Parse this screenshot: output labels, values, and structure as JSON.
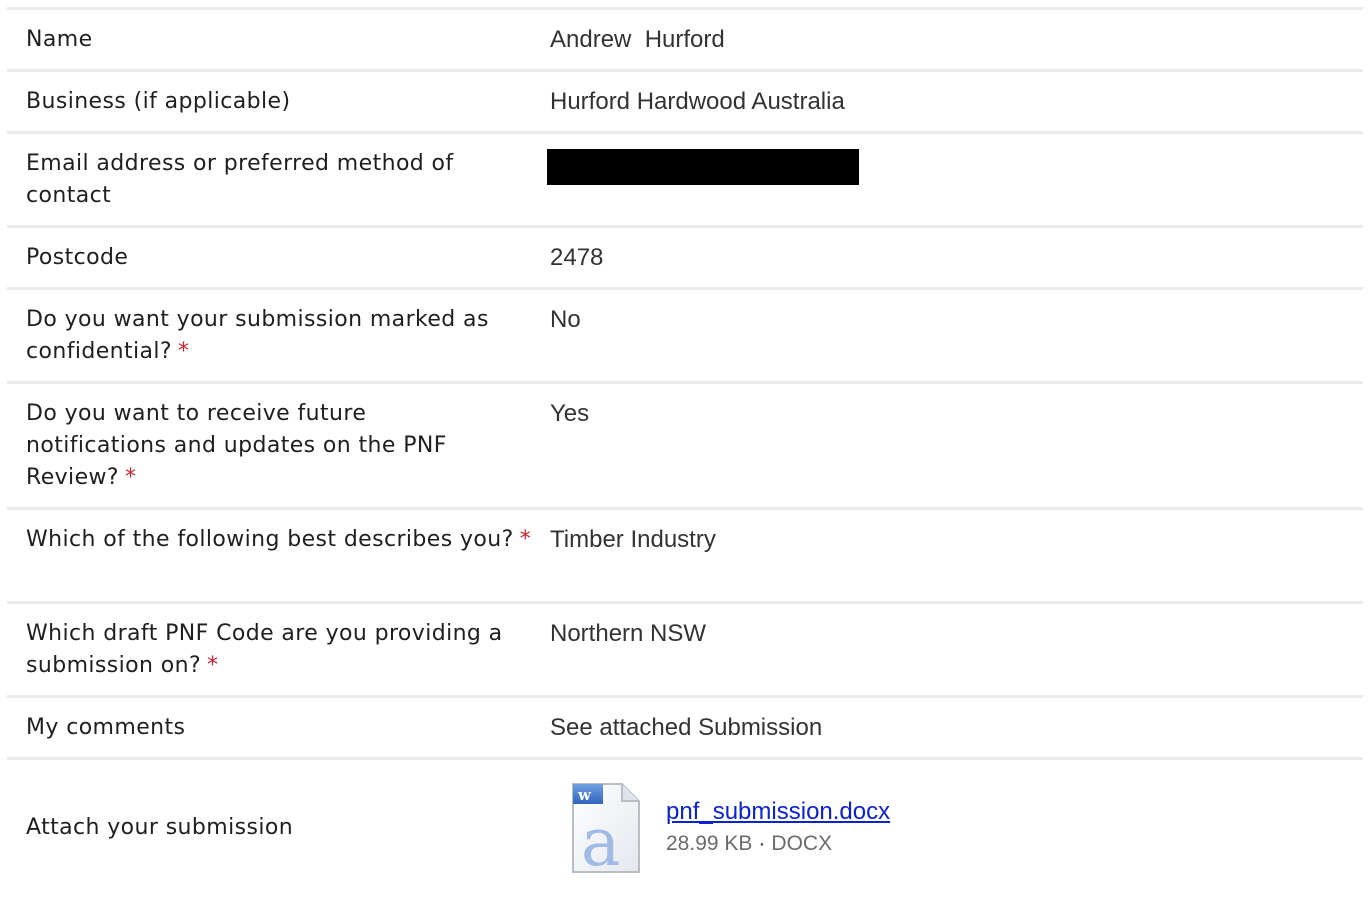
{
  "rows": [
    {
      "label": "Name",
      "required": false,
      "value": "Andrew  Hurford"
    },
    {
      "label": "Business (if applicable)",
      "required": false,
      "value": "Hurford Hardwood Australia"
    },
    {
      "label": "Email address or preferred method of contact",
      "required": false,
      "value": ""
    },
    {
      "label": "Postcode",
      "required": false,
      "value": "2478"
    },
    {
      "label": "Do you want your submission marked as confidential?",
      "required": true,
      "value": "No"
    },
    {
      "label": "Do you want to receive future notifications and updates on the PNF Review?",
      "required": true,
      "value": "Yes"
    },
    {
      "label": "Which of the following best describes you?",
      "required": true,
      "value": "Timber Industry"
    },
    {
      "label": "Which draft PNF Code are you providing a submission on?",
      "required": true,
      "value": "Northern NSW"
    },
    {
      "label": "My comments",
      "required": false,
      "value": "See attached Submission"
    }
  ],
  "attachment": {
    "label": "Attach your submission",
    "file_name": "pnf_submission.docx",
    "file_size": "28.99 KB",
    "separator": "·",
    "file_type": "DOCX",
    "icon": "word-document-icon"
  },
  "required_marker": "*",
  "colors": {
    "required": "#d0202e",
    "link": "#0b22d4",
    "divider": "#ebebeb"
  }
}
